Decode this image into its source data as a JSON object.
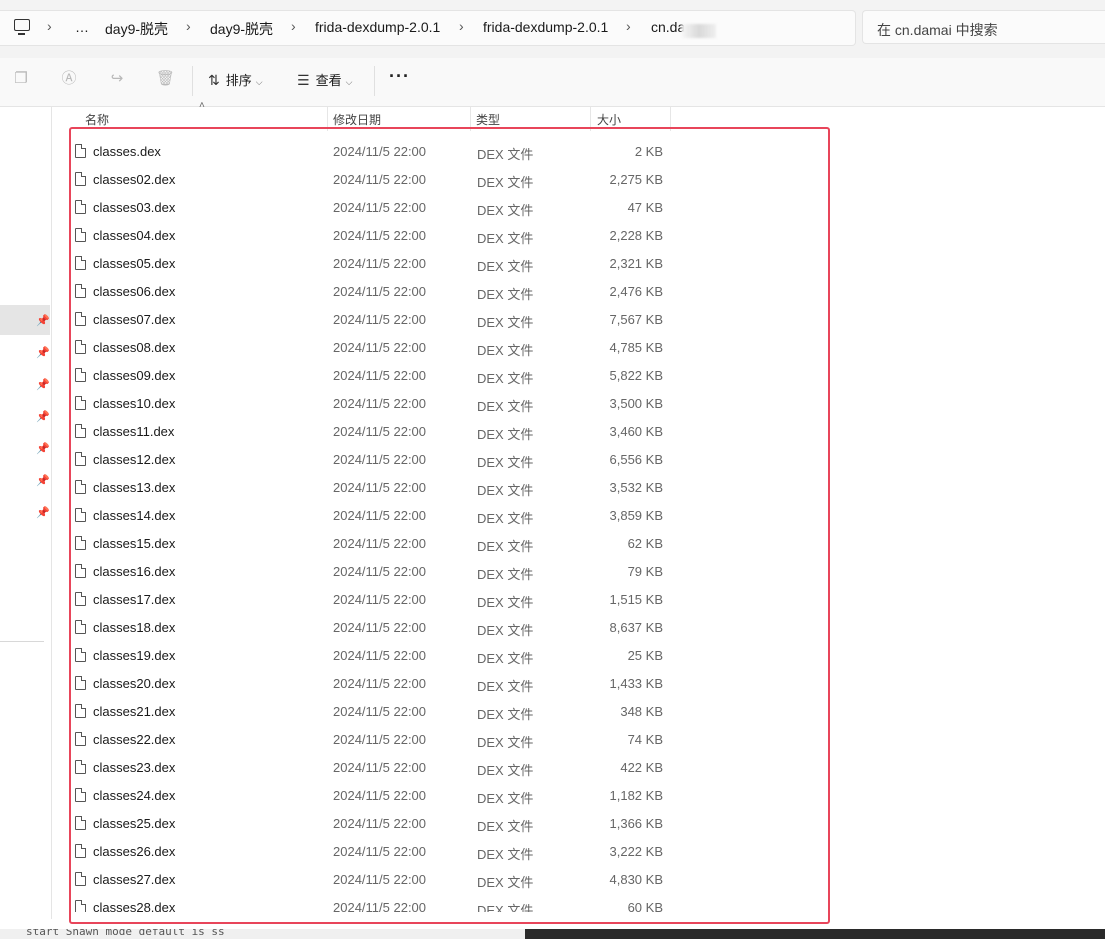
{
  "breadcrumb": {
    "items": [
      "…",
      "day9-脱壳",
      "day9-脱壳",
      "frida-dexdump-2.0.1",
      "frida-dexdump-2.0.1",
      "cn.da"
    ]
  },
  "search": {
    "placeholder": "在 cn.damai 中搜索"
  },
  "toolbar": {
    "sort_label": "排序",
    "view_label": "查看",
    "more_label": "···"
  },
  "columns": {
    "name": "名称",
    "date": "修改日期",
    "type": "类型",
    "size": "大小"
  },
  "files": [
    {
      "name": "classes.dex",
      "date": "2024/11/5 22:00",
      "type": "DEX 文件",
      "size": "2 KB"
    },
    {
      "name": "classes02.dex",
      "date": "2024/11/5 22:00",
      "type": "DEX 文件",
      "size": "2,275 KB"
    },
    {
      "name": "classes03.dex",
      "date": "2024/11/5 22:00",
      "type": "DEX 文件",
      "size": "47 KB"
    },
    {
      "name": "classes04.dex",
      "date": "2024/11/5 22:00",
      "type": "DEX 文件",
      "size": "2,228 KB"
    },
    {
      "name": "classes05.dex",
      "date": "2024/11/5 22:00",
      "type": "DEX 文件",
      "size": "2,321 KB"
    },
    {
      "name": "classes06.dex",
      "date": "2024/11/5 22:00",
      "type": "DEX 文件",
      "size": "2,476 KB"
    },
    {
      "name": "classes07.dex",
      "date": "2024/11/5 22:00",
      "type": "DEX 文件",
      "size": "7,567 KB"
    },
    {
      "name": "classes08.dex",
      "date": "2024/11/5 22:00",
      "type": "DEX 文件",
      "size": "4,785 KB"
    },
    {
      "name": "classes09.dex",
      "date": "2024/11/5 22:00",
      "type": "DEX 文件",
      "size": "5,822 KB"
    },
    {
      "name": "classes10.dex",
      "date": "2024/11/5 22:00",
      "type": "DEX 文件",
      "size": "3,500 KB"
    },
    {
      "name": "classes11.dex",
      "date": "2024/11/5 22:00",
      "type": "DEX 文件",
      "size": "3,460 KB"
    },
    {
      "name": "classes12.dex",
      "date": "2024/11/5 22:00",
      "type": "DEX 文件",
      "size": "6,556 KB"
    },
    {
      "name": "classes13.dex",
      "date": "2024/11/5 22:00",
      "type": "DEX 文件",
      "size": "3,532 KB"
    },
    {
      "name": "classes14.dex",
      "date": "2024/11/5 22:00",
      "type": "DEX 文件",
      "size": "3,859 KB"
    },
    {
      "name": "classes15.dex",
      "date": "2024/11/5 22:00",
      "type": "DEX 文件",
      "size": "62 KB"
    },
    {
      "name": "classes16.dex",
      "date": "2024/11/5 22:00",
      "type": "DEX 文件",
      "size": "79 KB"
    },
    {
      "name": "classes17.dex",
      "date": "2024/11/5 22:00",
      "type": "DEX 文件",
      "size": "1,515 KB"
    },
    {
      "name": "classes18.dex",
      "date": "2024/11/5 22:00",
      "type": "DEX 文件",
      "size": "8,637 KB"
    },
    {
      "name": "classes19.dex",
      "date": "2024/11/5 22:00",
      "type": "DEX 文件",
      "size": "25 KB"
    },
    {
      "name": "classes20.dex",
      "date": "2024/11/5 22:00",
      "type": "DEX 文件",
      "size": "1,433 KB"
    },
    {
      "name": "classes21.dex",
      "date": "2024/11/5 22:00",
      "type": "DEX 文件",
      "size": "348 KB"
    },
    {
      "name": "classes22.dex",
      "date": "2024/11/5 22:00",
      "type": "DEX 文件",
      "size": "74 KB"
    },
    {
      "name": "classes23.dex",
      "date": "2024/11/5 22:00",
      "type": "DEX 文件",
      "size": "422 KB"
    },
    {
      "name": "classes24.dex",
      "date": "2024/11/5 22:00",
      "type": "DEX 文件",
      "size": "1,182 KB"
    },
    {
      "name": "classes25.dex",
      "date": "2024/11/5 22:00",
      "type": "DEX 文件",
      "size": "1,366 KB"
    },
    {
      "name": "classes26.dex",
      "date": "2024/11/5 22:00",
      "type": "DEX 文件",
      "size": "3,222 KB"
    },
    {
      "name": "classes27.dex",
      "date": "2024/11/5 22:00",
      "type": "DEX 文件",
      "size": "4,830 KB"
    },
    {
      "name": "classes28.dex",
      "date": "2024/11/5 22:00",
      "type": "DEX 文件",
      "size": "60 KB"
    }
  ],
  "bottom_text": "start   Shawn mode default  is ss",
  "colors": {
    "highlight": "#e8455a",
    "selected_nav": "#e5e5e5"
  }
}
